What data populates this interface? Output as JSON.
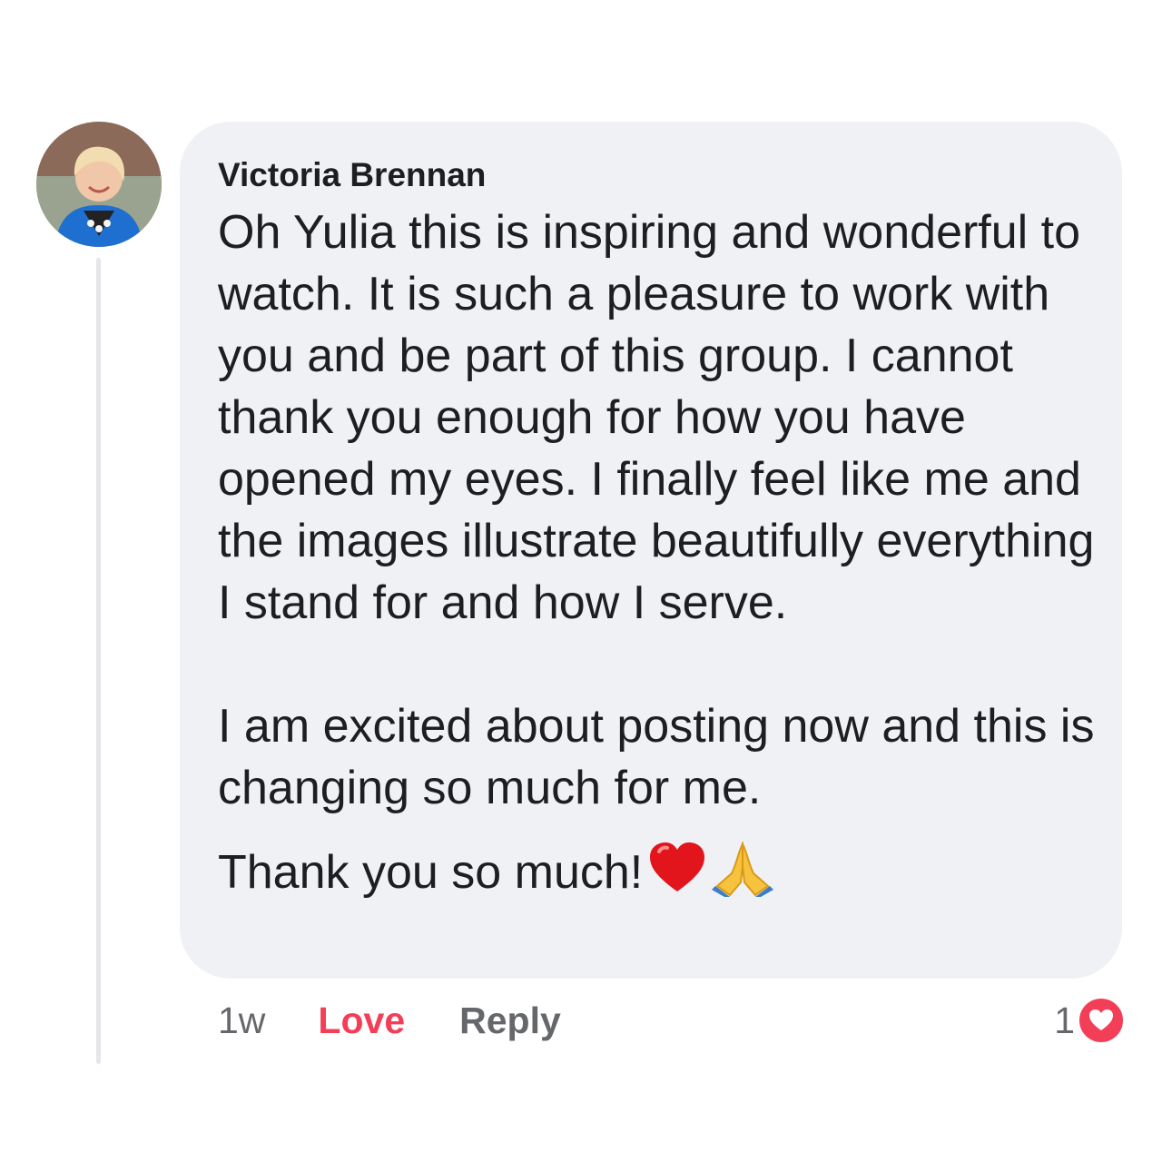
{
  "comment": {
    "author": "Victoria Brennan",
    "paragraphs": [
      "Oh Yulia this is inspiring and wonderful to watch.  It is such a pleasure to work with you and be part of this group.  I cannot thank you enough for how you have opened my eyes.  I finally feel like me and the images illustrate beautifully everything I stand for and how I serve.",
      "I am excited about posting now and this is changing so much for me.",
      "Thank you so much!"
    ],
    "emojis": [
      "red-heart-emoji",
      "folded-hands-emoji"
    ]
  },
  "actions": {
    "time": "1w",
    "love_label": "Love",
    "reply_label": "Reply"
  },
  "reactions": {
    "count": "1",
    "icon": "love-reaction-icon"
  },
  "colors": {
    "love": "#f33e58",
    "bubble": "#f0f1f5",
    "muted": "#65676b",
    "thread_line": "#e4e6eb"
  }
}
